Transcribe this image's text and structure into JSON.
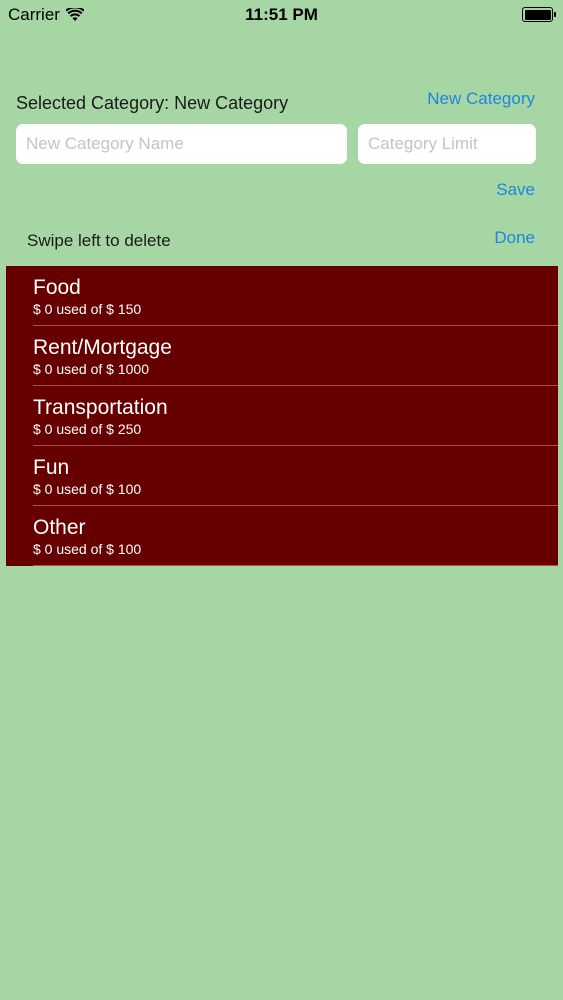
{
  "status_bar": {
    "carrier": "Carrier",
    "time": "11:51 PM"
  },
  "header": {
    "selected_label": "Selected Category: New Category",
    "new_category_label": "New Category"
  },
  "form": {
    "name_placeholder": "New Category Name",
    "limit_placeholder": "Category Limit",
    "save_label": "Save"
  },
  "list_header": {
    "hint": "Swipe left to delete",
    "done_label": "Done"
  },
  "categories": [
    {
      "name": "Food",
      "usage": "$ 0 used of $ 150"
    },
    {
      "name": "Rent/Mortgage",
      "usage": "$ 0 used of $ 1000"
    },
    {
      "name": "Transportation",
      "usage": "$ 0 used of $ 250"
    },
    {
      "name": "Fun",
      "usage": "$ 0 used of $ 100"
    },
    {
      "name": "Other",
      "usage": "$ 0 used of $ 100"
    }
  ],
  "colors": {
    "background": "#a7d6a5",
    "list_background": "#660000",
    "accent": "#1e86e0"
  }
}
